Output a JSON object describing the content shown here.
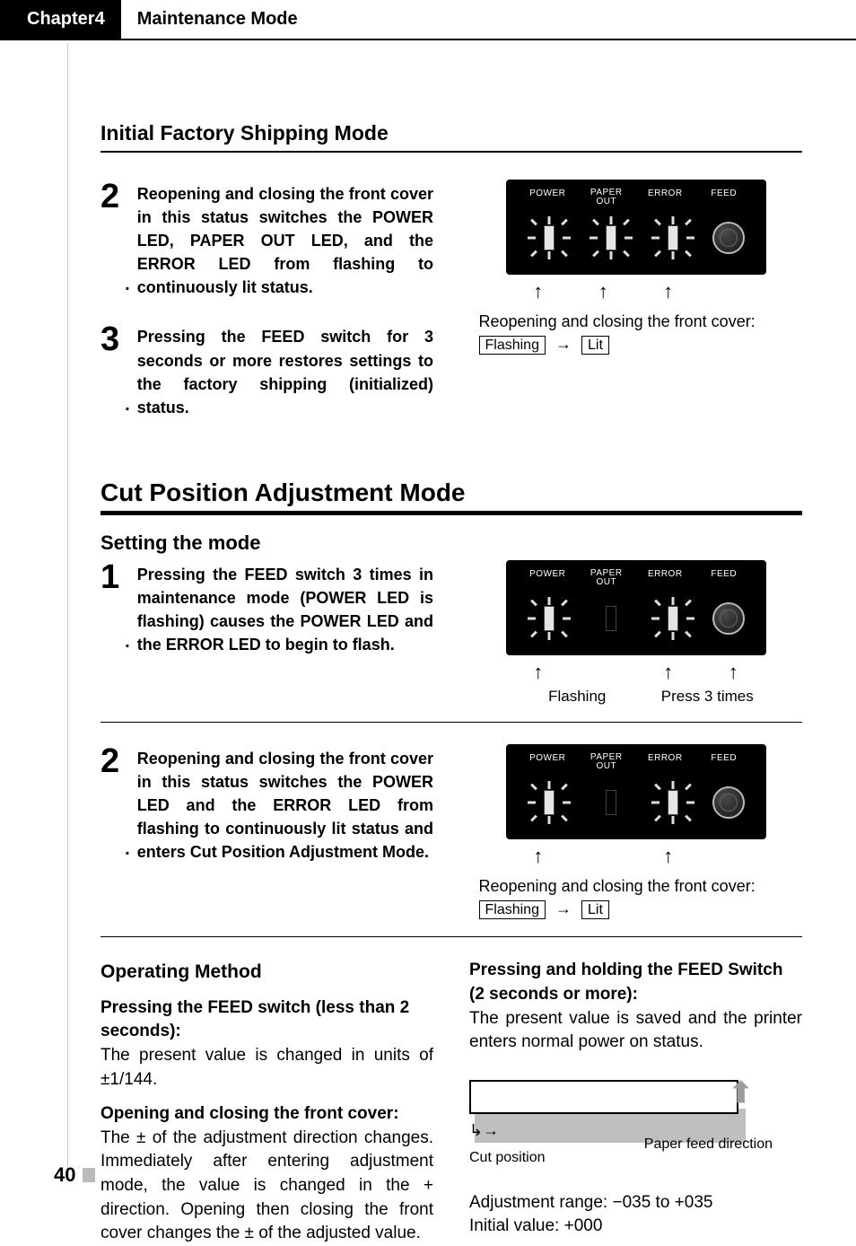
{
  "header": {
    "chapter": "Chapter4",
    "title": "Maintenance Mode"
  },
  "section1": {
    "title": "Initial Factory Shipping Mode",
    "step2": "Reopening and closing the front cover in this status switches the POWER LED, PAPER OUT LED, and the ERROR LED from flashing to continuously lit status.",
    "step3": "Pressing the FEED switch for 3 seconds or more restores settings to the factory shipping (initialized) status."
  },
  "section2": {
    "title": "Cut Position Adjustment Mode",
    "subtitle": "Setting the mode",
    "step1": "Pressing the FEED switch 3 times in maintenance mode (POWER LED is flashing) causes the POWER LED and the ERROR LED to begin to flash.",
    "step2": "Reopening and closing the front cover in this status switches the POWER LED and the ERROR LED from flashing to continuously lit status and enters Cut Position Adjustment Mode."
  },
  "panel_labels": {
    "power": "POWER",
    "paper_out_top": "PAPER",
    "paper_out_bot": "OUT",
    "error": "ERROR",
    "feed": "FEED"
  },
  "captions": {
    "reopen": "Reopening and closing the front cover:",
    "flashing": "Flashing",
    "lit": "Lit",
    "press3": "Press 3 times"
  },
  "operating": {
    "title": "Operating Method",
    "press_short_h": "Pressing the FEED switch (less than 2 seconds):",
    "press_short_b": "The present value is changed in units of ±1/144.",
    "cover_h": "Opening and closing the front cover:",
    "cover_b": "The ± of the adjustment direction changes. Immediately after entering adjustment mode, the value is changed in the + direction. Opening then closing the front cover changes the ± of the adjusted value.",
    "press_long_h": "Pressing and holding the FEED Switch (2 seconds or more):",
    "press_long_b": "The present value is saved and the printer enters normal power on status.",
    "cut_pos": "Cut position",
    "feed_dir": "Paper feed direction",
    "range": "Adjustment range: −035 to +035",
    "initial": "Initial value: +000"
  },
  "page_number": "40",
  "chart_data": {
    "type": "table",
    "title": "Cut Position Adjustment",
    "values": {
      "adjustment_range_min": -35,
      "adjustment_range_max": 35,
      "initial_value": 0,
      "step_unit": "1/144"
    }
  }
}
